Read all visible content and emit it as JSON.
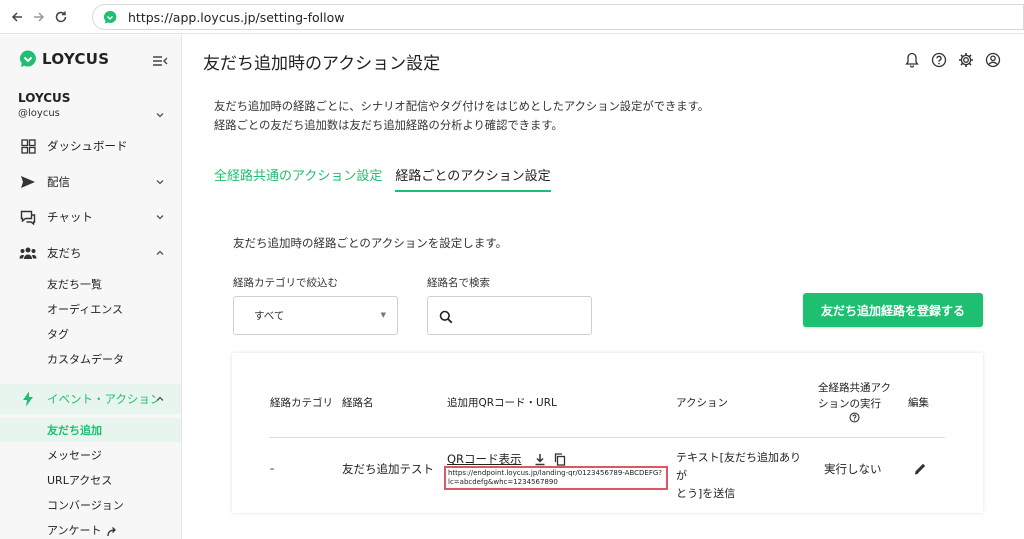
{
  "browser": {
    "url": "https://app.loycus.jp/setting-follow"
  },
  "sidebar": {
    "logo": "LOYCUS",
    "account_name": "LOYCUS",
    "account_id": "@loycus",
    "items": [
      {
        "label": "ダッシュボード",
        "icon": "dashboard-icon"
      },
      {
        "label": "配信",
        "icon": "send-icon"
      },
      {
        "label": "チャット",
        "icon": "chat-icon"
      },
      {
        "label": "友だち",
        "icon": "people-icon"
      }
    ],
    "friends_sub": [
      "友だち一覧",
      "オーディエンス",
      "タグ",
      "カスタムデータ"
    ],
    "event_section": "イベント・アクション",
    "event_sub": [
      "友だち追加",
      "メッセージ",
      "URLアクセス",
      "コンバージョン",
      "アンケート"
    ]
  },
  "main": {
    "title": "友だち追加時のアクション設定",
    "description_line1": "友だち追加時の経路ごとに、シナリオ配信やタグ付けをはじめとしたアクション設定ができます。",
    "description_line2": "経路ごとの友だち追加数は友だち追加経路の分析より確認できます。",
    "tabs": [
      {
        "label": "全経路共通のアクション設定"
      },
      {
        "label": "経路ごとのアクション設定"
      }
    ],
    "section_desc": "友だち追加時の経路ごとのアクションを設定します。",
    "filter_label": "経路カテゴリで絞込む",
    "filter_value": "すべて",
    "search_label": "経路名で検索",
    "search_placeholder": "",
    "register_button": "友だち追加経路を登録する"
  },
  "table": {
    "headers": {
      "category": "経路カテゴリ",
      "name": "経路名",
      "qr": "追加用QRコード・URL",
      "action": "アクション",
      "common_line1": "全経路共通アク",
      "common_line2": "ションの実行",
      "edit": "編集"
    },
    "row": {
      "category": "-",
      "name": "友だち追加テスト",
      "qr_link": "QRコード表示",
      "url_line1": "https://endpoint.loycus.jp/landing-qr/0123456789-ABCDEFG?",
      "url_line2": "lc=abcdefg&whc=1234567890",
      "action_line1": "テキスト[友だち追加ありが",
      "action_line2": "とう]を送信",
      "common": "実行しない"
    }
  },
  "colors": {
    "brand_green": "#1fbf71",
    "highlight_red": "#e05563"
  }
}
